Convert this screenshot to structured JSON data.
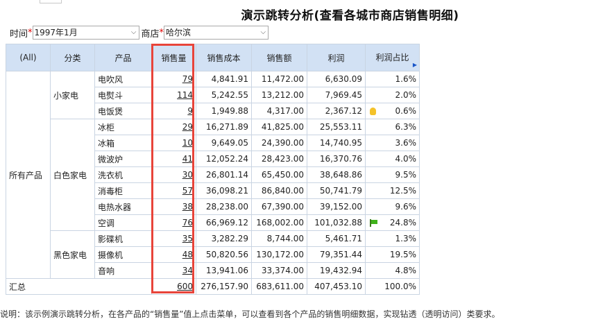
{
  "page": {
    "title": "演示跳转分析(查看各城市商店销售明细)"
  },
  "filters": {
    "time_label": "时间",
    "time_value": "1997年1月",
    "store_label": "商店",
    "store_value": "哈尔滨",
    "required_mark": "*"
  },
  "table": {
    "headers": {
      "all": "(All)",
      "category": "分类",
      "product": "产品",
      "qty": "销售量",
      "cost": "销售成本",
      "sales": "销售额",
      "profit": "利润",
      "ratio": "利润占比"
    },
    "level1": "所有产品",
    "groups": [
      "小家电",
      "白色家电",
      "黑色家电"
    ],
    "rows": [
      {
        "product": "电吹风",
        "qty": "79",
        "cost": "4,841.91",
        "sales": "11,472.00",
        "profit": "6,630.09",
        "ratio": "1.6%"
      },
      {
        "product": "电熨斗",
        "qty": "114",
        "cost": "5,242.55",
        "sales": "13,212.00",
        "profit": "7,969.45",
        "ratio": "2.0%"
      },
      {
        "product": "电饭煲",
        "qty": "9",
        "cost": "1,949.88",
        "sales": "4,317.00",
        "profit": "2,367.12",
        "ratio": "0.6%"
      },
      {
        "product": "冰柜",
        "qty": "29",
        "cost": "16,271.89",
        "sales": "41,825.00",
        "profit": "25,553.11",
        "ratio": "6.3%"
      },
      {
        "product": "冰箱",
        "qty": "10",
        "cost": "9,649.05",
        "sales": "24,390.00",
        "profit": "14,740.95",
        "ratio": "3.6%"
      },
      {
        "product": "微波炉",
        "qty": "41",
        "cost": "12,052.24",
        "sales": "28,423.00",
        "profit": "16,370.76",
        "ratio": "4.0%"
      },
      {
        "product": "洗衣机",
        "qty": "30",
        "cost": "26,801.14",
        "sales": "65,450.00",
        "profit": "38,648.86",
        "ratio": "9.5%"
      },
      {
        "product": "消毒柜",
        "qty": "57",
        "cost": "36,098.21",
        "sales": "86,840.00",
        "profit": "50,741.79",
        "ratio": "12.5%"
      },
      {
        "product": "电热水器",
        "qty": "38",
        "cost": "28,238.00",
        "sales": "67,390.00",
        "profit": "39,152.00",
        "ratio": "9.6%"
      },
      {
        "product": "空调",
        "qty": "76",
        "cost": "66,969.12",
        "sales": "168,002.00",
        "profit": "101,032.88",
        "ratio": "24.8%"
      },
      {
        "product": "影碟机",
        "qty": "35",
        "cost": "3,282.29",
        "sales": "8,744.00",
        "profit": "5,461.71",
        "ratio": "1.3%"
      },
      {
        "product": "摄像机",
        "qty": "48",
        "cost": "50,820.56",
        "sales": "130,172.00",
        "profit": "79,351.44",
        "ratio": "19.5%"
      },
      {
        "product": "音响",
        "qty": "34",
        "cost": "13,941.06",
        "sales": "33,374.00",
        "profit": "19,432.94",
        "ratio": "4.8%"
      }
    ],
    "total": {
      "label": "汇总",
      "qty": "600",
      "cost": "276,157.90",
      "sales": "683,611.00",
      "profit": "407,453.10",
      "ratio": "100.0%"
    }
  },
  "note": "说明：该示例演示跳转分析，在各产品的“销售量”值上点击菜单，可以查看到各个产品的销售明细数据，实现钻透（透明访问）类要求。",
  "colors": {
    "header_bg": "#d2e1f4",
    "border": "#c9d4e2",
    "highlight_box": "#e8443a",
    "required": "#e00000"
  },
  "icons": {
    "bulb": "lightbulb-icon",
    "flag": "green-flag-icon",
    "dropdown": "chevron-down-icon",
    "header_arrow": "triangle-right-icon"
  }
}
